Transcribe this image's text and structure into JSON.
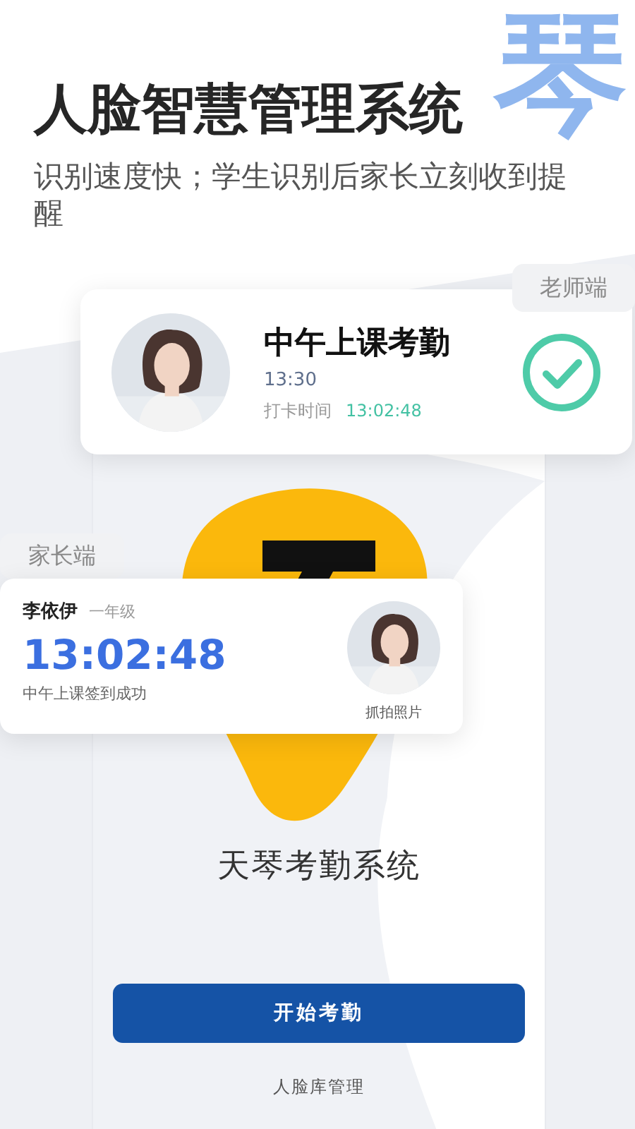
{
  "backdrop_glyph": "琴",
  "headline": "人脸智慧管理系统",
  "subtitle": "识别速度快；学生识别后家长立刻收到提醒",
  "teacher_card": {
    "tag": "老师端",
    "title": "中午上课考勤",
    "class_time": "13:30",
    "punch_label": "打卡时间",
    "punch_time": "13:02:48",
    "checked": true
  },
  "parent_card": {
    "tag": "家长端",
    "student": "李依伊",
    "grade": "一年级",
    "time": "13:02:48",
    "message": "中午上课签到成功",
    "photo_caption": "抓拍照片"
  },
  "app": {
    "title": "天琴考勤系统",
    "primary_button": "开始考勤",
    "link": "人脸库管理"
  }
}
